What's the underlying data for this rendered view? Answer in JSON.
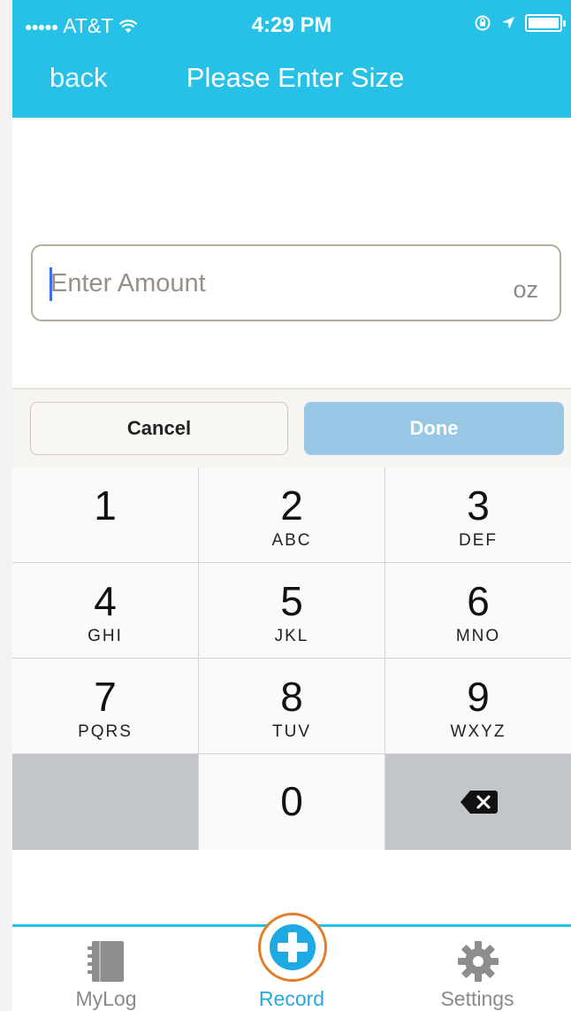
{
  "status_bar": {
    "signal_dots": "●●●●●",
    "carrier": "AT&T",
    "time": "4:29 PM"
  },
  "nav": {
    "back_label": "back",
    "title": "Please Enter Size"
  },
  "amount_field": {
    "value": "",
    "placeholder": "Enter Amount",
    "unit": "oz"
  },
  "keyboard_toolbar": {
    "cancel_label": "Cancel",
    "done_label": "Done"
  },
  "keypad": {
    "keys": [
      {
        "digit": "1",
        "letters": ""
      },
      {
        "digit": "2",
        "letters": "ABC"
      },
      {
        "digit": "3",
        "letters": "DEF"
      },
      {
        "digit": "4",
        "letters": "GHI"
      },
      {
        "digit": "5",
        "letters": "JKL"
      },
      {
        "digit": "6",
        "letters": "MNO"
      },
      {
        "digit": "7",
        "letters": "PQRS"
      },
      {
        "digit": "8",
        "letters": "TUV"
      },
      {
        "digit": "9",
        "letters": "WXYZ"
      },
      {
        "digit": "0",
        "letters": ""
      }
    ]
  },
  "tabbar": {
    "items": [
      {
        "label": "MyLog",
        "icon": "notebook-icon"
      },
      {
        "label": "Record",
        "icon": "plus-icon"
      },
      {
        "label": "Settings",
        "icon": "gear-icon"
      }
    ]
  },
  "colors": {
    "accent": "#27c1e8",
    "record_ring": "#e27d2a",
    "done_button": "#98c8e5"
  }
}
